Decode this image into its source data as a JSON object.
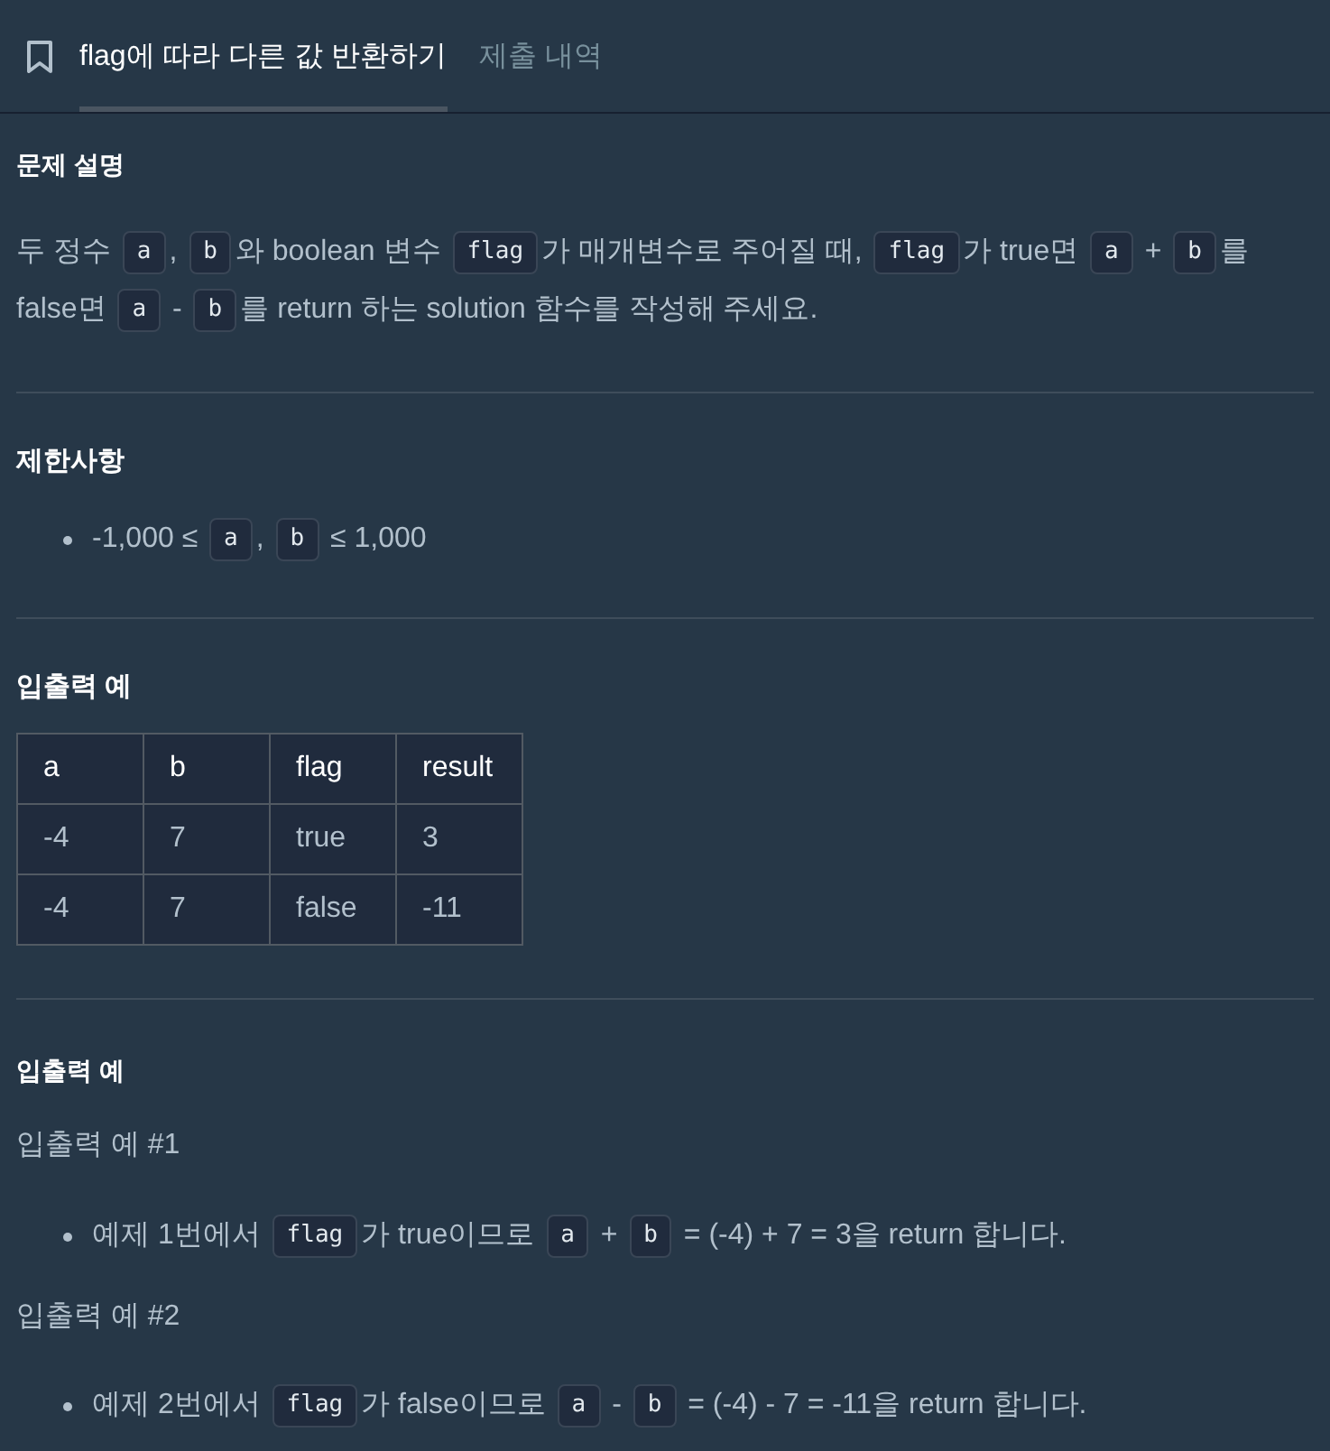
{
  "header": {
    "tabs": [
      {
        "label": "flag에 따라 다른 값 반환하기",
        "selected": true
      },
      {
        "label": "제출 내역",
        "selected": false
      }
    ]
  },
  "description": {
    "title": "문제 설명",
    "segments": [
      {
        "kind": "text",
        "text": "두 정수 "
      },
      {
        "kind": "code",
        "text": "a"
      },
      {
        "kind": "text",
        "text": ", "
      },
      {
        "kind": "code",
        "text": "b"
      },
      {
        "kind": "text",
        "text": "와 boolean 변수 "
      },
      {
        "kind": "code",
        "text": "flag"
      },
      {
        "kind": "text",
        "text": "가 매개변수로 주어질 때, "
      },
      {
        "kind": "code",
        "text": "flag"
      },
      {
        "kind": "text",
        "text": "가 true면 "
      },
      {
        "kind": "code",
        "text": "a"
      },
      {
        "kind": "text",
        "text": " + "
      },
      {
        "kind": "code",
        "text": "b"
      },
      {
        "kind": "text",
        "text": "를 false면 "
      },
      {
        "kind": "code",
        "text": "a"
      },
      {
        "kind": "text",
        "text": " - "
      },
      {
        "kind": "code",
        "text": "b"
      },
      {
        "kind": "text",
        "text": "를 return 하는 solution 함수를 작성해 주세요."
      }
    ]
  },
  "constraints": {
    "title": "제한사항",
    "items": [
      [
        {
          "kind": "text",
          "text": "-1,000 ≤ "
        },
        {
          "kind": "code",
          "text": "a"
        },
        {
          "kind": "text",
          "text": ", "
        },
        {
          "kind": "code",
          "text": "b"
        },
        {
          "kind": "text",
          "text": " ≤ 1,000"
        }
      ]
    ]
  },
  "examples_table": {
    "title": "입출력 예",
    "columns": [
      "a",
      "b",
      "flag",
      "result"
    ],
    "rows": [
      [
        "-4",
        "7",
        "true",
        "3"
      ],
      [
        "-4",
        "7",
        "false",
        "-11"
      ]
    ]
  },
  "examples_explanation": {
    "title": "입출력 예",
    "examples": [
      {
        "subtitle": "입출력 예 #1",
        "items": [
          [
            {
              "kind": "text",
              "text": "예제 1번에서 "
            },
            {
              "kind": "code",
              "text": "flag"
            },
            {
              "kind": "text",
              "text": "가 true이므로 "
            },
            {
              "kind": "code",
              "text": "a"
            },
            {
              "kind": "text",
              "text": " + "
            },
            {
              "kind": "code",
              "text": "b"
            },
            {
              "kind": "text",
              "text": " = (-4) + 7 = 3을 return 합니다."
            }
          ]
        ]
      },
      {
        "subtitle": "입출력 예 #2",
        "items": [
          [
            {
              "kind": "text",
              "text": "예제 2번에서 "
            },
            {
              "kind": "code",
              "text": "flag"
            },
            {
              "kind": "text",
              "text": "가 false이므로 "
            },
            {
              "kind": "code",
              "text": "a"
            },
            {
              "kind": "text",
              "text": " - "
            },
            {
              "kind": "code",
              "text": "b"
            },
            {
              "kind": "text",
              "text": " = (-4) - 7 = -11을 return 합니다."
            }
          ]
        ]
      }
    ]
  }
}
